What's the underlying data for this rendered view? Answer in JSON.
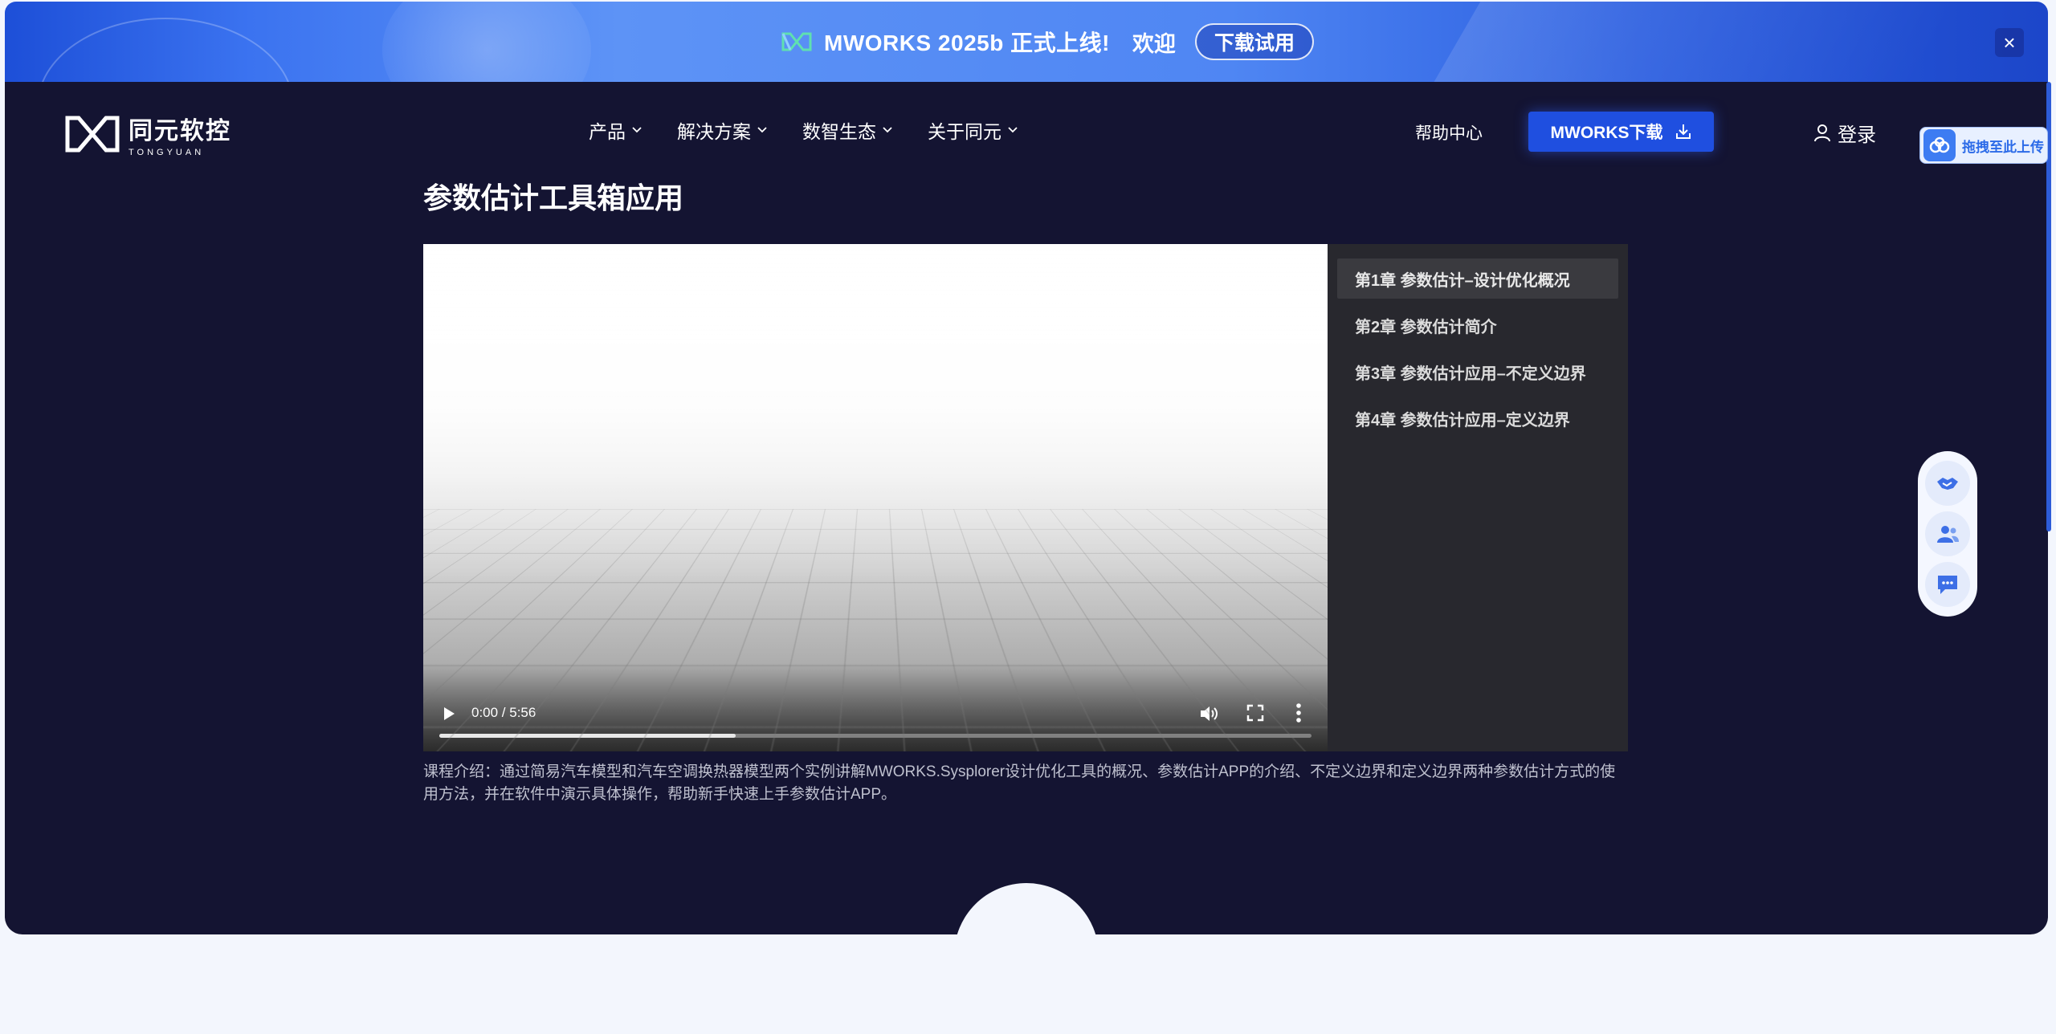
{
  "banner": {
    "product_text": "MWORKS 2025b 正式上线!",
    "welcome_text": "欢迎",
    "try_button": "下载试用",
    "close_label": "×"
  },
  "header": {
    "logo_cn": "同元软控",
    "logo_en": "TONGYUAN",
    "nav": [
      {
        "label": "产品"
      },
      {
        "label": "解决方案"
      },
      {
        "label": "数智生态"
      },
      {
        "label": "关于同元"
      }
    ],
    "help": "帮助中心",
    "download_button": "MWORKS下载",
    "login": "登录",
    "upload_tag": "拖拽至此上传"
  },
  "main": {
    "title": "参数估计工具箱应用",
    "video": {
      "time": "0:00 / 5:56",
      "progress": 0.34
    },
    "chapters": [
      {
        "label": "第1章 参数估计–设计优化概况",
        "active": true
      },
      {
        "label": "第2章 参数估计简介"
      },
      {
        "label": "第3章 参数估计应用–不定义边界"
      },
      {
        "label": "第4章 参数估计应用–定义边界"
      }
    ],
    "description": "课程介绍：通过简易汽车模型和汽车空调换热器模型两个实例讲解MWORKS.Sysplorer设计优化工具的概况、参数估计APP的介绍、不定义边界和定义边界两种参数估计方式的使用方法，并在软件中演示具体操作，帮助新手快速上手参数估计APP。"
  },
  "colors": {
    "dark_bg": "#141432",
    "accent": "#1f4fe0",
    "banner_blue": "#3b73f0"
  },
  "side_widget": [
    "handshake-icon",
    "users-icon",
    "chat-icon"
  ]
}
